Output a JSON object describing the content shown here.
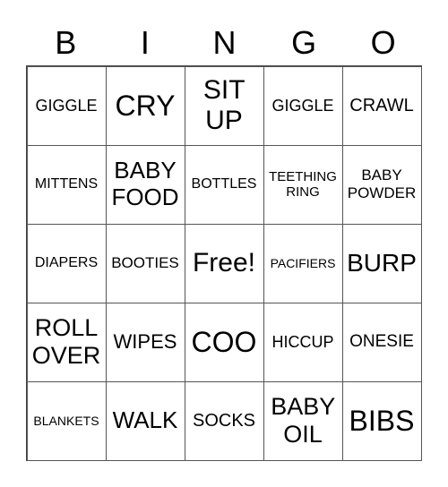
{
  "header": [
    "B",
    "I",
    "N",
    "G",
    "O"
  ],
  "cells": [
    [
      "GIGGLE",
      "CRY",
      "SIT UP",
      "GIGGLE",
      "CRAWL"
    ],
    [
      "MITTENS",
      "BABY FOOD",
      "BOTTLES",
      "TEETHING RING",
      "BABY POWDER"
    ],
    [
      "DIAPERS",
      "BOOTIES",
      "Free!",
      "PACIFIERS",
      "BURP"
    ],
    [
      "ROLL OVER",
      "WIPES",
      "COO",
      "HICCUP",
      "ONESIE"
    ],
    [
      "BLANKETS",
      "WALK",
      "SOCKS",
      "BABY OIL",
      "BIBS"
    ]
  ]
}
